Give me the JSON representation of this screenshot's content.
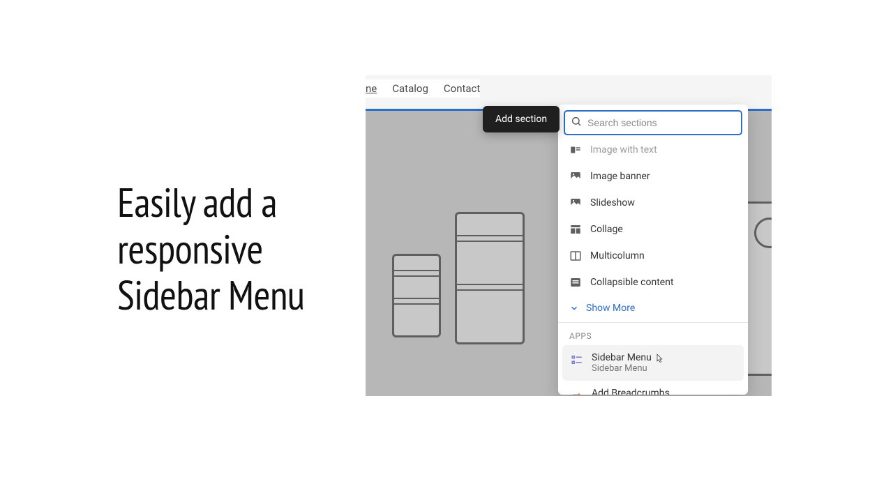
{
  "headline": "Easily add a\nresponsive\nSidebar Menu",
  "nav": {
    "home_fragment": "ne",
    "catalog": "Catalog",
    "contact": "Contact"
  },
  "tooltip": "Add section",
  "search": {
    "placeholder": "Search sections"
  },
  "sections": {
    "image_with_text_cut": "Image with text",
    "image_banner": "Image banner",
    "slideshow": "Slideshow",
    "collage": "Collage",
    "multicolumn": "Multicolumn",
    "collapsible_content": "Collapsible content",
    "show_more": "Show More"
  },
  "apps_header": "APPS",
  "apps": {
    "sidebar_menu": {
      "title": "Sidebar Menu",
      "subtitle": "Sidebar Menu"
    },
    "add_breadcrumbs": {
      "title": "Add Breadcrumbs"
    }
  }
}
